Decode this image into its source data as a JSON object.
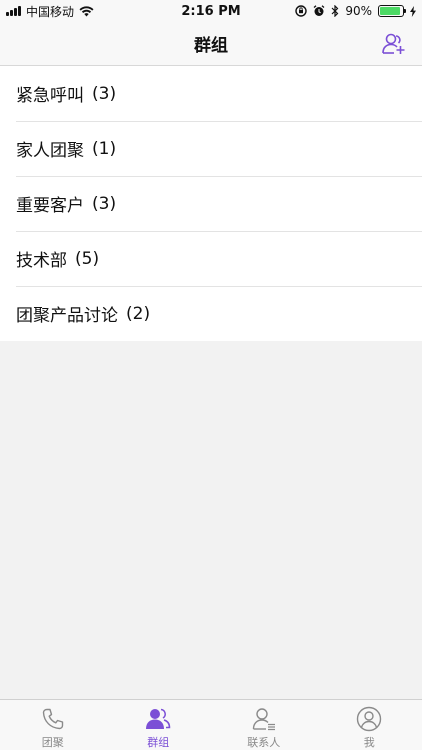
{
  "status": {
    "carrier": "中国移动",
    "time": "2:16 PM",
    "battery_pct": "90%",
    "battery_level": 0.9
  },
  "nav": {
    "title": "群组"
  },
  "groups": [
    {
      "name": "紧急呼叫",
      "count": "(3)"
    },
    {
      "name": "家人团聚",
      "count": "(1)"
    },
    {
      "name": "重要客户",
      "count": "(3)"
    },
    {
      "name": "技术部",
      "count": "(5)"
    },
    {
      "name": "团聚产品讨论",
      "count": "(2)"
    }
  ],
  "tabs": [
    {
      "label": "团聚",
      "icon": "phone-icon",
      "active": false
    },
    {
      "label": "群组",
      "icon": "group-icon",
      "active": true
    },
    {
      "label": "联系人",
      "icon": "contacts-icon",
      "active": false
    },
    {
      "label": "我",
      "icon": "profile-icon",
      "active": false
    }
  ],
  "colors": {
    "accent": "#7b4fd6",
    "inactive": "#888888",
    "battery": "#4cd964"
  }
}
